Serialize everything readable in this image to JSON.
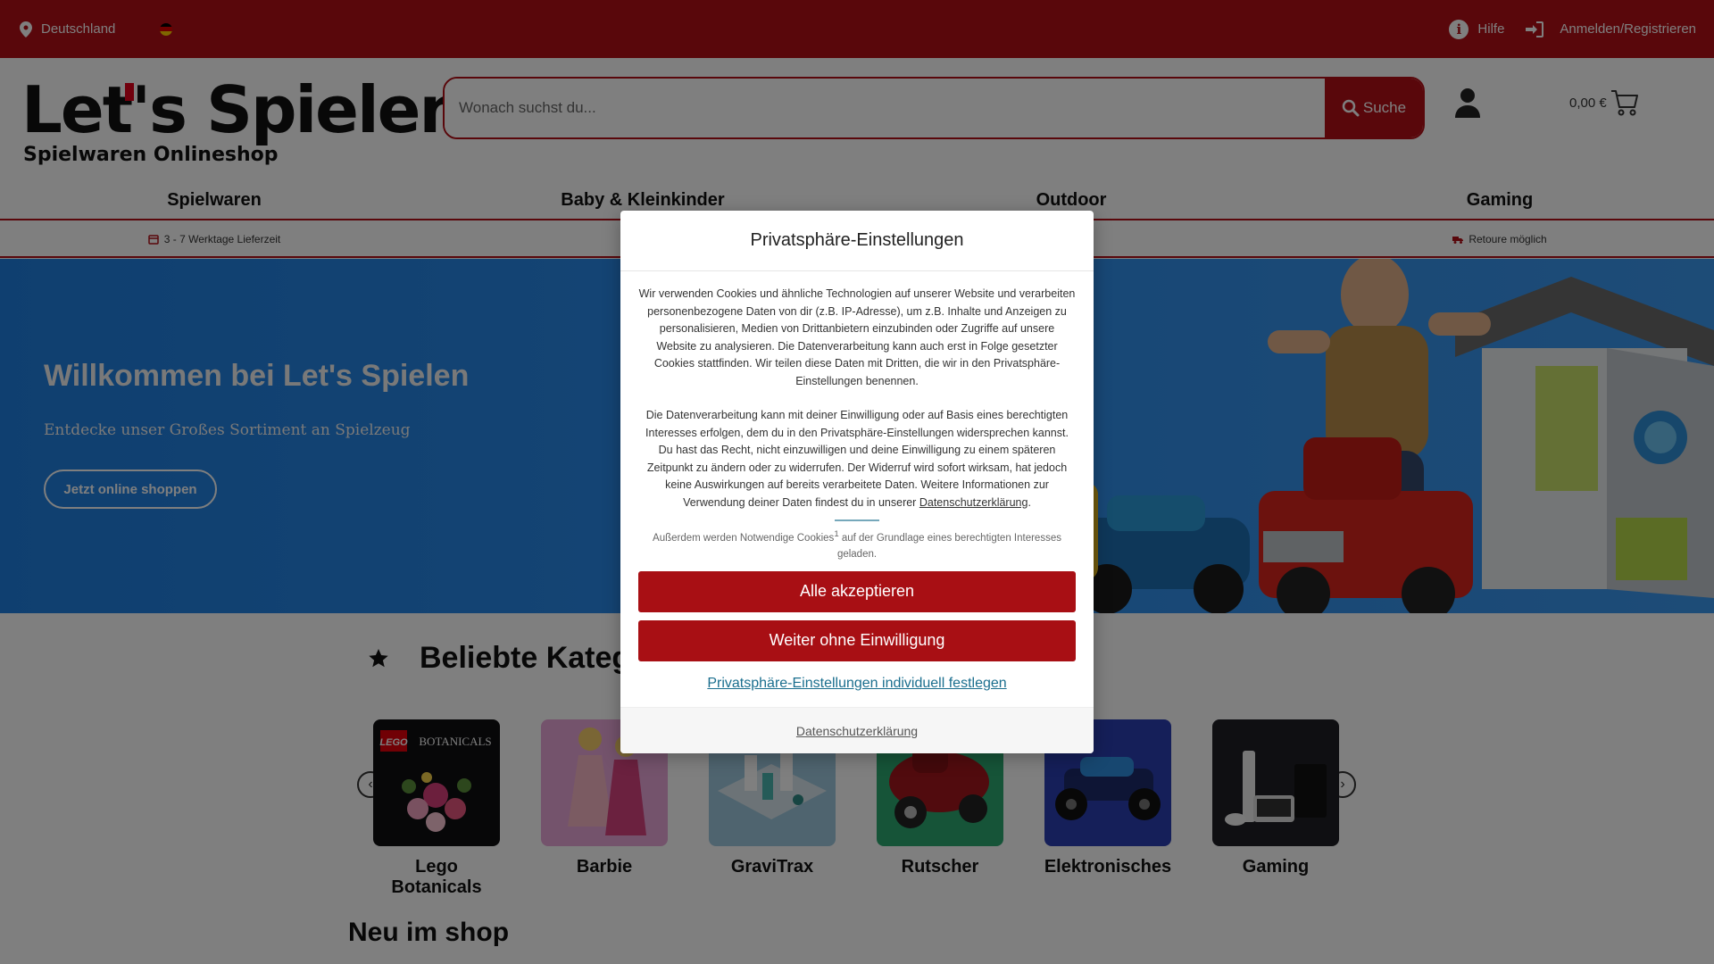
{
  "topbar": {
    "location": "Deutschland",
    "help": "Hilfe",
    "login": "Anmelden/Registrieren"
  },
  "logo": {
    "title": "Let's Spielen",
    "subtitle": "Spielwaren Onlineshop"
  },
  "search": {
    "placeholder": "Wonach suchst du...",
    "button": "Suche"
  },
  "cart": {
    "total": "0,00 €"
  },
  "nav": [
    "Spielwaren",
    "Baby & Kleinkinder",
    "Outdoor",
    "Gaming"
  ],
  "usps": [
    "3 - 7 Werktage Lieferzeit",
    "Retoure möglich"
  ],
  "hero": {
    "title": "Willkommen bei Let's Spielen",
    "subtitle": "Entdecke unser Großes Sortiment an Spielzeug",
    "button": "Jetzt online shoppen"
  },
  "categories": {
    "heading": "Beliebte Kateg",
    "items": [
      {
        "label": "Lego Botanicals",
        "img_text": "BOTANICALS",
        "brand": "LEGO"
      },
      {
        "label": "Barbie"
      },
      {
        "label": "GraviTrax"
      },
      {
        "label": "Rutscher"
      },
      {
        "label": "Elektronisches"
      },
      {
        "label": "Gaming"
      }
    ]
  },
  "new_heading": "Neu im shop",
  "modal": {
    "title": "Privatsphäre-Einstellungen",
    "para1": "Wir verwenden Cookies und ähnliche Technologien auf unserer Website und verarbeiten personenbezogene Daten von dir (z.B. IP-Adresse), um z.B. Inhalte und Anzeigen zu personalisieren, Medien von Drittanbietern einzubinden oder Zugriffe auf unsere Website zu analysieren. Die Datenverarbeitung kann auch erst in Folge gesetzter Cookies stattfinden. Wir teilen diese Daten mit Dritten, die wir in den Privatsphäre-Einstellungen benennen.",
    "para2": "Die Datenverarbeitung kann mit deiner Einwilligung oder auf Basis eines berechtigten Interesses erfolgen, dem du in den Privatsphäre-Einstellungen widersprechen kannst. Du hast das Recht, nicht einzuwilligen und deine Einwilligung zu einem späteren Zeitpunkt zu ändern oder zu widerrufen. Der Widerruf wird sofort wirksam, hat jedoch keine Auswirkungen auf bereits verarbeitete Daten. Weitere Informationen zur Verwendung deiner Daten findest du in unserer",
    "para2_link": "Datenschutzerklärung",
    "note_pre": "Außerdem werden Notwendige Cookies",
    "note_sup": "1",
    "note_post": " auf der Grundlage eines berechtigten Interesses geladen.",
    "accept_all": "Alle akzeptieren",
    "continue_without": "Weiter ohne Einwilligung",
    "individual": "Privatsphäre-Einstellungen individuell festlegen",
    "footer_link": "Datenschutzerklärung"
  },
  "colors": {
    "brand_red": "#b30f17",
    "button_red": "#a80f14",
    "hero_blue": "#2b8bea",
    "link_teal": "#1a6e8e"
  }
}
